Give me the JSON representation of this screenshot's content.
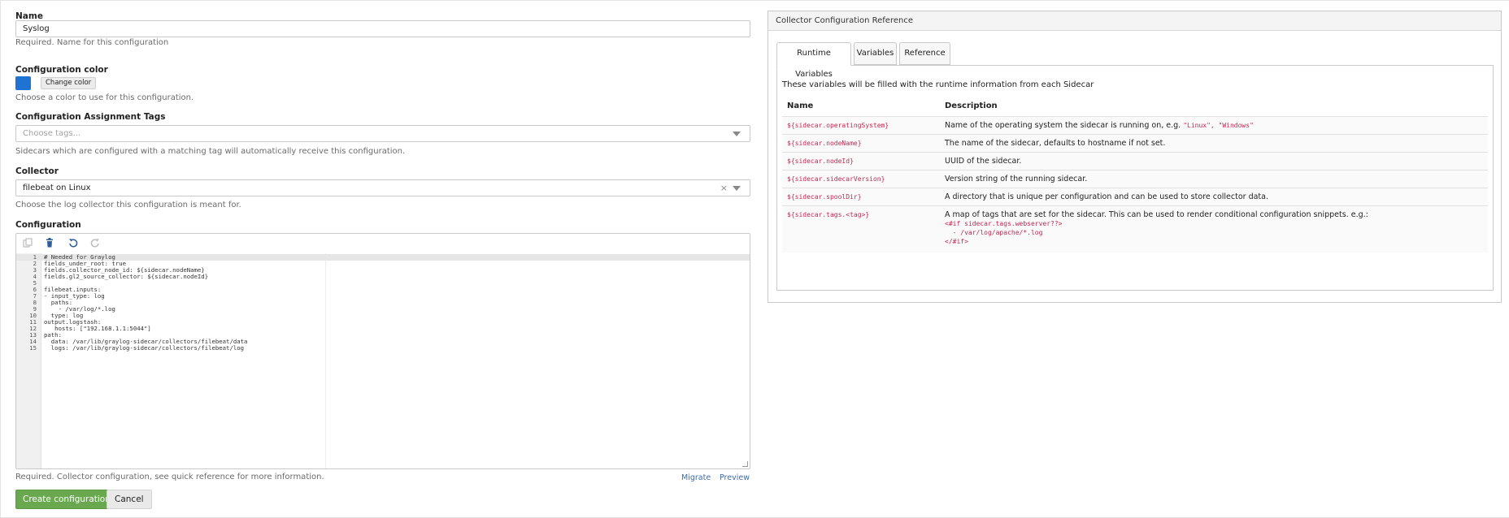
{
  "form": {
    "name_label": "Name",
    "name_value": "Syslog",
    "name_help": "Required. Name for this configuration",
    "color_label": "Configuration color",
    "color_value": "#1f73d2",
    "change_color_label": "Change color",
    "color_help": "Choose a color to use for this configuration.",
    "tags_label": "Configuration Assignment Tags",
    "tags_placeholder": "Choose tags...",
    "tags_help": "Sidecars which are configured with a matching tag will automatically receive this configuration.",
    "collector_label": "Collector",
    "collector_value": "filebeat on Linux",
    "collector_clear": "×",
    "collector_help": "Choose the log collector this configuration is meant for.",
    "configuration_label": "Configuration",
    "configuration_help": "Required. Collector configuration, see quick reference for more information.",
    "migrate_label": "Migrate",
    "preview_label": "Preview",
    "create_label": "Create configuration",
    "cancel_label": "Cancel"
  },
  "editor": {
    "toolbar_icons": [
      "copy-icon",
      "trash-icon",
      "undo-icon",
      "redo-icon"
    ],
    "lines": [
      {
        "n": "1",
        "text": "# Needed for Graylog"
      },
      {
        "n": "2",
        "text": "fields_under_root: true"
      },
      {
        "n": "3",
        "text": "fields.collector_node_id: ${sidecar.nodeName}"
      },
      {
        "n": "4",
        "text": "fields.gl2_source_collector: ${sidecar.nodeId}"
      },
      {
        "n": "5",
        "text": ""
      },
      {
        "n": "6",
        "text": "filebeat.inputs:"
      },
      {
        "n": "7",
        "text": "- input_type: log"
      },
      {
        "n": "8",
        "text": "  paths:"
      },
      {
        "n": "9",
        "text": "    - /var/log/*.log"
      },
      {
        "n": "10",
        "text": "  type: log"
      },
      {
        "n": "11",
        "text": "output.logstash:"
      },
      {
        "n": "12",
        "text": "   hosts: [\"192.168.1.1:5044\"]"
      },
      {
        "n": "13",
        "text": "path:"
      },
      {
        "n": "14",
        "text": "  data: /var/lib/graylog-sidecar/collectors/filebeat/data"
      },
      {
        "n": "15",
        "text": "  logs: /var/lib/graylog-sidecar/collectors/filebeat/log"
      }
    ]
  },
  "reference": {
    "title": "Collector Configuration Reference",
    "tabs": [
      {
        "label": "Runtime Variables"
      },
      {
        "label": "Variables"
      },
      {
        "label": "Reference"
      }
    ],
    "intro": "These variables will be filled with the runtime information from each Sidecar",
    "col_name": "Name",
    "col_description": "Description",
    "rows": [
      {
        "var": "${sidecar.operatingSystem}",
        "desc": "Name of the operating system the sidecar is running on, e.g. ",
        "code": "\"Linux\", \"Windows\""
      },
      {
        "var": "${sidecar.nodeName}",
        "desc": "The name of the sidecar, defaults to hostname if not set."
      },
      {
        "var": "${sidecar.nodeId}",
        "desc": "UUID of the sidecar."
      },
      {
        "var": "${sidecar.sidecarVersion}",
        "desc": "Version string of the running sidecar."
      },
      {
        "var": "${sidecar.spoolDir}",
        "desc": "A directory that is unique per configuration and can be used to store collector data."
      },
      {
        "var": "${sidecar.tags.<tag>}",
        "desc": "A map of tags that are set for the sidecar. This can be used to render conditional configuration snippets. e.g.:",
        "snippet": [
          "<#if sidecar.tags.webserver??>",
          "  - /var/log/apache/*.log",
          "</#if>"
        ]
      }
    ]
  }
}
